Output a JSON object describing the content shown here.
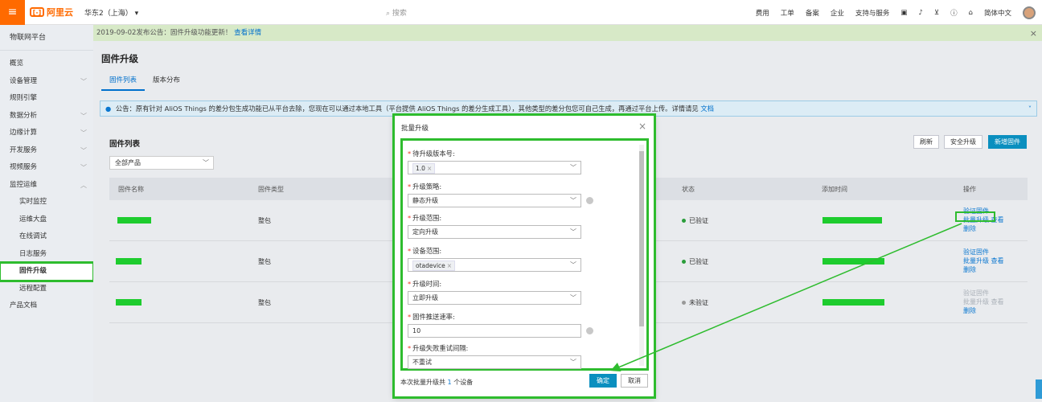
{
  "topbar": {
    "menu_icon": "menu-icon",
    "logo_text": "阿里云",
    "region": "华东2（上海）",
    "search_placeholder": "搜索",
    "links": [
      "费用",
      "工单",
      "备案",
      "企业",
      "支持与服务"
    ],
    "language": "简体中文"
  },
  "sidebar": {
    "title": "物联网平台",
    "items": [
      {
        "label": "概览",
        "chev": false
      },
      {
        "label": "设备管理",
        "chev": true
      },
      {
        "label": "规则引擎",
        "chev": false
      },
      {
        "label": "数据分析",
        "chev": true
      },
      {
        "label": "边缘计算",
        "chev": true
      },
      {
        "label": "开发服务",
        "chev": true
      },
      {
        "label": "视频服务",
        "chev": true
      },
      {
        "label": "监控运维",
        "chev": true
      }
    ],
    "sub_items": [
      "实时监控",
      "运维大盘",
      "在线调试",
      "日志服务",
      "固件升级",
      "远程配置"
    ],
    "active": "固件升级",
    "last_item": "产品文档"
  },
  "notice": {
    "text": "2019-09-02发布公告：固件升级功能更新！",
    "link": "查看详情"
  },
  "page": {
    "title": "固件升级",
    "tabs": [
      "固件列表",
      "版本分布"
    ],
    "active_tab": "固件列表"
  },
  "alert": {
    "text": "公告：原有针对 AliOS Things 的差分包生成功能已从平台去除，您现在可以通过本地工具（平台提供 AliOS Things 的差分生成工具），其他类型的差分包您可自己生成，再通过平台上传。详情请见",
    "link": "文档"
  },
  "firmware_list": {
    "title": "固件列表",
    "product_filter": "全部产品",
    "buttons": {
      "refresh": "刷新",
      "secure_upgrade": "安全升级",
      "add_firmware": "新增固件"
    },
    "columns": [
      "固件名称",
      "固件类型",
      "状态",
      "添加时间",
      "操作"
    ],
    "rows": [
      {
        "type": "整包",
        "status": "已验证",
        "status_color": "#2a9d3a",
        "ops": [
          "验证固件",
          "批量升级",
          "查看",
          "删除"
        ]
      },
      {
        "type": "整包",
        "status": "已验证",
        "status_color": "#2a9d3a",
        "ops": [
          "验证固件",
          "批量升级",
          "查看",
          "删除"
        ]
      },
      {
        "type": "整包",
        "status": "未验证",
        "status_color": "#999999",
        "ops": [
          "验证固件",
          "批量升级",
          "查看",
          "删除"
        ]
      }
    ]
  },
  "modal": {
    "title": "批量升级",
    "fields": [
      {
        "label": "待升级版本号:",
        "value": "",
        "tag": "1.0",
        "required": true,
        "help": false
      },
      {
        "label": "升级策略:",
        "value": "静态升级",
        "required": true,
        "help": true
      },
      {
        "label": "升级范围:",
        "value": "定向升级",
        "required": true,
        "help": false
      },
      {
        "label": "设备范围:",
        "value": "",
        "tag": "otadevice",
        "required": true,
        "help": false
      },
      {
        "label": "升级时间:",
        "value": "立即升级",
        "required": true,
        "help": false
      },
      {
        "label": "固件推送速率:",
        "value": "10",
        "required": true,
        "help": true
      },
      {
        "label": "升级失败重试间隔:",
        "value": "不重试",
        "required": true,
        "help": false
      }
    ],
    "footer_prefix": "本次批量升级共",
    "footer_count": "1",
    "footer_suffix": "个设备",
    "confirm": "确定",
    "cancel": "取消"
  },
  "colors": {
    "accent": "#ff6a00",
    "primary": "#0a8fbf",
    "highlight": "#2ebc2e",
    "link": "#0a77d0"
  }
}
